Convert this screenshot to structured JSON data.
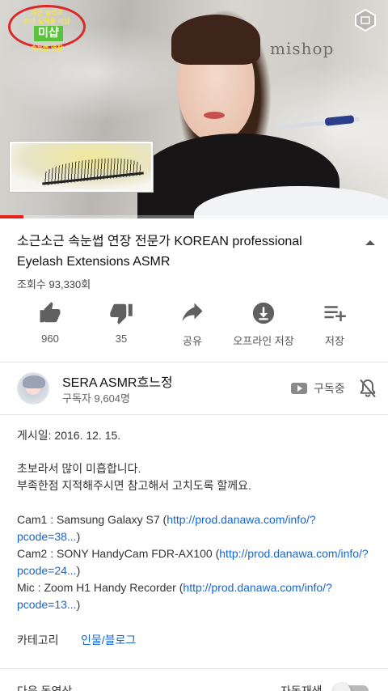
{
  "player": {
    "logo_badge": {
      "line1": "미선 송선로",
      "line2": "최대 오락용 미샵",
      "main": "미샵",
      "line3": "속눈썹 연장"
    },
    "brand_text": "mishop",
    "progress": 0.06,
    "icon": "hexagon-cube-icon"
  },
  "video": {
    "title": "소근소근 속눈썹 연장 전문가  KOREAN professional Eyelash Extensions ASMR",
    "views": "조회수 93,330회"
  },
  "actions": [
    {
      "icon": "thumbs-up-icon",
      "label": "960"
    },
    {
      "icon": "thumbs-down-icon",
      "label": "35"
    },
    {
      "icon": "share-icon",
      "label": "공유"
    },
    {
      "icon": "download-icon",
      "label": "오프라인 저장"
    },
    {
      "icon": "playlist-add-icon",
      "label": "저장"
    }
  ],
  "channel": {
    "name": "SERA ASMR흐느정",
    "subscribers": "구독자 9,604명",
    "subscribed_label": "구독중"
  },
  "description": {
    "posted": "게시일: 2016. 12. 15.",
    "note_line1": "초보라서 많이 미흡합니다.",
    "note_line2": "부족한점 지적해주시면 참고해서 고치도록 할께요.",
    "gear": [
      {
        "prefix": "Cam1 : Samsung Galaxy S7 (",
        "link": "http://prod.danawa.com/info/?pcode=38...",
        "suffix": ")"
      },
      {
        "prefix": "Cam2 : SONY HandyCam FDR-AX100 (",
        "link": "http://prod.danawa.com/info/?pcode=24...",
        "suffix": ")"
      },
      {
        "prefix": "Mic : Zoom H1 Handy Recorder (",
        "link": "http://prod.danawa.com/info/?pcode=13...",
        "suffix": ")"
      }
    ],
    "category_key": "카테고리",
    "category_value": "인물/블로그"
  },
  "next": {
    "label": "다음 동영상",
    "autoplay_label": "자동재생",
    "autoplay_on": false
  }
}
